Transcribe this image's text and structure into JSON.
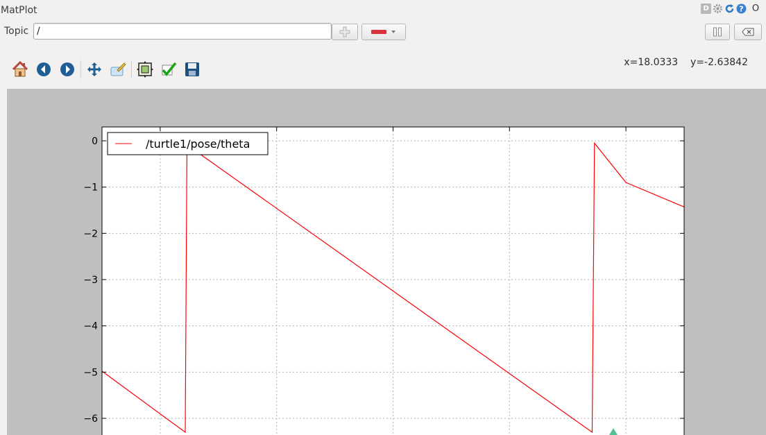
{
  "window": {
    "title": "MatPlot",
    "close_glyph": "O"
  },
  "topic": {
    "label": "Topic",
    "value": "/"
  },
  "toolbar": {
    "tools": [
      "home-icon",
      "back-icon",
      "forward-icon",
      "pan-icon",
      "zoom-rect-icon",
      "subplots-icon",
      "edit-curves-icon",
      "save-icon"
    ]
  },
  "status": {
    "x_readout": "x=18.0333",
    "y_readout": "y=-2.63842"
  },
  "colors": {
    "line": "#ff0000",
    "canvas": "#bfbfbf",
    "plot_bg": "#ffffff"
  },
  "chart_data": {
    "type": "line",
    "title": "",
    "xlabel": "",
    "ylabel": "",
    "ylim": [
      -6.6,
      0.3
    ],
    "xlim": [
      0,
      1
    ],
    "yticks": [
      0,
      -1,
      -2,
      -3,
      -4,
      -5,
      -6
    ],
    "ytick_labels": [
      "0",
      "−1",
      "−2",
      "−3",
      "−4",
      "−5",
      "−6"
    ],
    "grid": true,
    "legend": {
      "position": "top-left",
      "entries": [
        "/turtle1/pose/theta"
      ]
    },
    "series": [
      {
        "name": "/turtle1/pose/theta",
        "color": "#ff0000",
        "x": [
          0.0,
          0.143,
          0.146,
          0.17,
          0.842,
          0.846,
          0.9,
          1.0
        ],
        "y": [
          -4.98,
          -6.3,
          -0.02,
          -0.3,
          -6.3,
          -0.05,
          -0.9,
          -1.43
        ]
      }
    ]
  }
}
